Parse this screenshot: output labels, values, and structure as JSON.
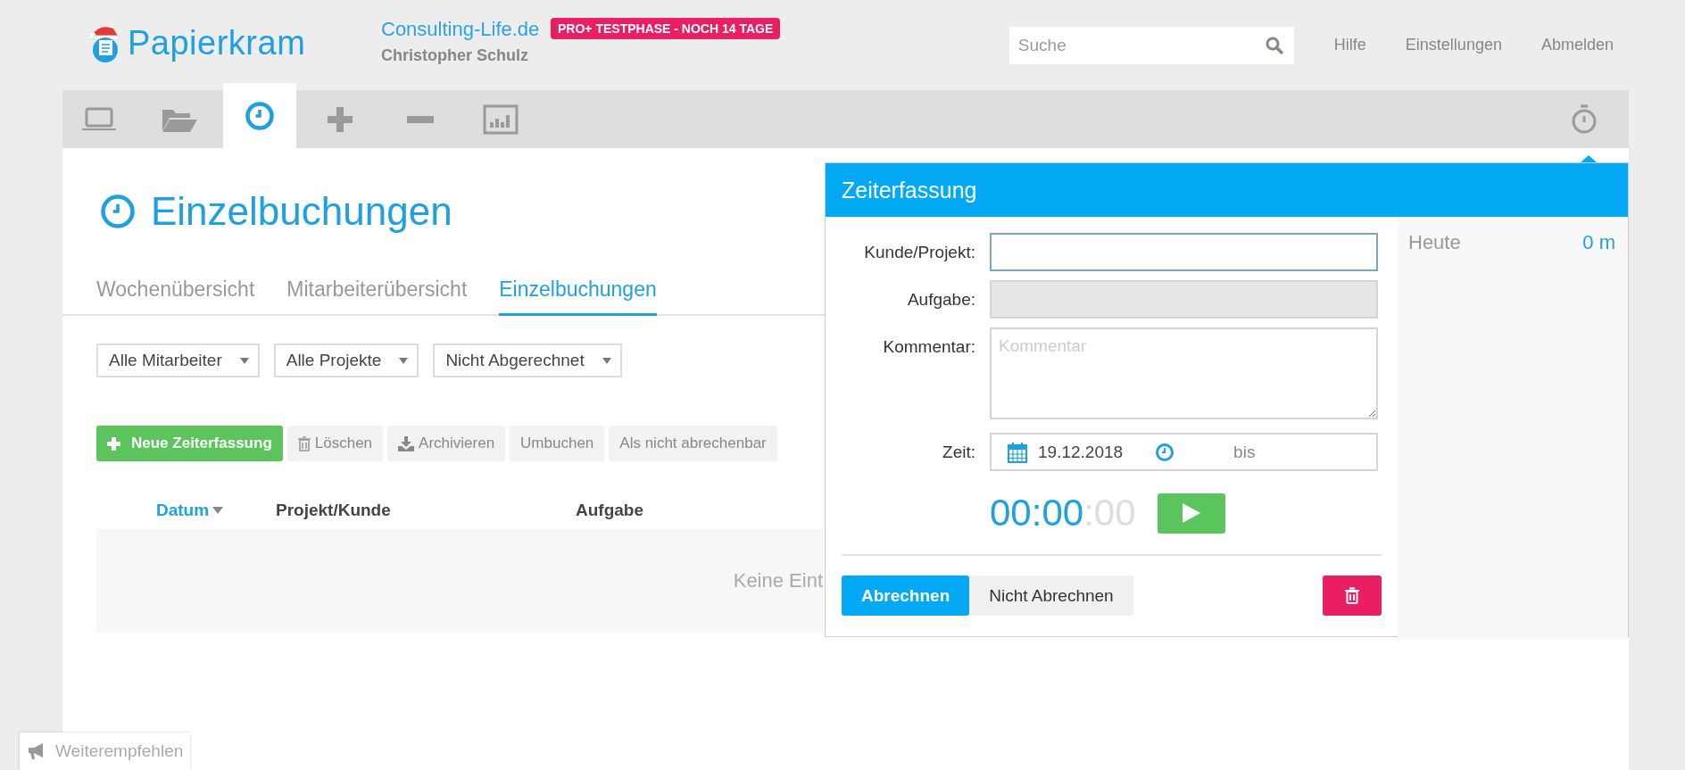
{
  "header": {
    "logo": "Papierkram",
    "company": "Consulting-Life.de",
    "user": "Christopher Schulz",
    "badge": "PRO+ TESTPHASE - NOCH 14 TAGE",
    "search": {
      "placeholder": "Suche"
    },
    "links": [
      "Hilfe",
      "Einstellungen",
      "Abmelden"
    ]
  },
  "nav": {
    "items": [
      {
        "kind": "laptop",
        "selected": false
      },
      {
        "kind": "folder",
        "selected": false
      },
      {
        "kind": "clock",
        "selected": true
      },
      {
        "kind": "plus",
        "selected": false
      },
      {
        "kind": "minus",
        "selected": false
      },
      {
        "kind": "chart",
        "selected": false
      }
    ]
  },
  "page": {
    "title": "Einzelbuchungen",
    "tabs": [
      {
        "label": "Wochenübersicht",
        "selected": false
      },
      {
        "label": "Mitarbeiterübersicht",
        "selected": false
      },
      {
        "label": "Einzelbuchungen",
        "selected": true
      }
    ],
    "filters": [
      "Alle Mitarbeiter",
      "Alle Projekte",
      "Nicht Abgerechnet"
    ],
    "actions": [
      {
        "kind": "primary",
        "label": "Neue Zeiterfassung"
      },
      {
        "kind": "delete",
        "label": "Löschen"
      },
      {
        "kind": "archive",
        "label": "Archivieren"
      },
      {
        "kind": "plain",
        "label": "Umbuchen"
      },
      {
        "kind": "plain",
        "label": "Als nicht abrechenbar"
      }
    ],
    "table": {
      "columns": [
        {
          "label": "Datum",
          "sorted": true
        },
        {
          "label": "Projekt/Kunde",
          "sorted": false
        },
        {
          "label": "Aufgabe",
          "sorted": false
        }
      ],
      "empty_message": "Keine Eint"
    }
  },
  "popup": {
    "title": "Zeiterfassung",
    "fields": [
      {
        "kind": "text",
        "label": "Kunde/Projekt:",
        "focused": true,
        "disabled": false
      },
      {
        "kind": "text",
        "label": "Aufgabe:",
        "focused": false,
        "disabled": true
      },
      {
        "kind": "textarea",
        "label": "Kommentar:",
        "placeholder": "Kommentar",
        "focused": false,
        "disabled": false
      },
      {
        "kind": "time",
        "label": "Zeit:",
        "date": "19.12.2018",
        "until": "bis",
        "focused": false,
        "disabled": false
      }
    ],
    "timer": {
      "elapsed": "00:00",
      "seconds": ":00"
    },
    "billing": [
      {
        "label": "Abrechnen",
        "selected": true
      },
      {
        "label": "Nicht Abrechnen",
        "selected": false
      }
    ],
    "today": {
      "label": "Heute",
      "value": "0 m"
    }
  },
  "recommend": "Weiterempfehlen"
}
